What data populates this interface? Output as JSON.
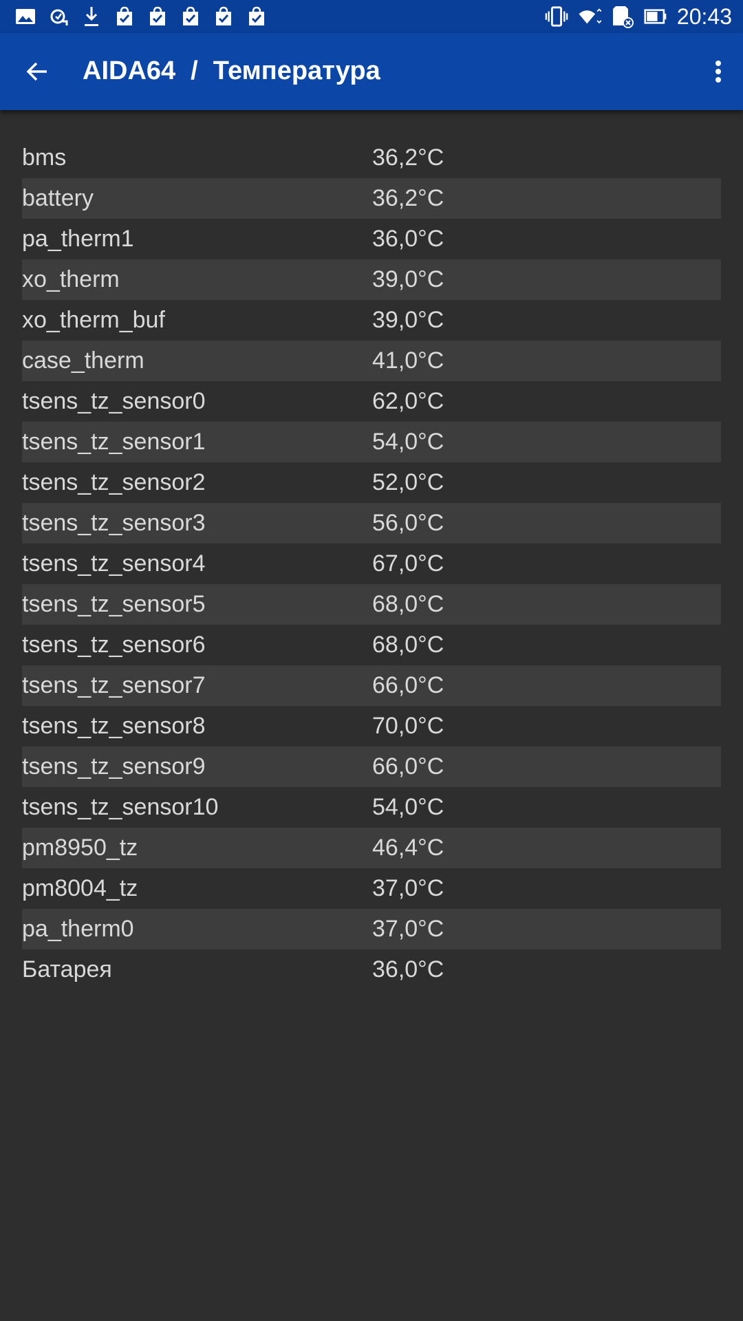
{
  "status_bar": {
    "time": "20:43",
    "left_icons": [
      "gallery-icon",
      "sync-icon",
      "download-icon",
      "bag-check-icon",
      "bag-check-icon",
      "bag-check-icon",
      "bag-check-icon",
      "bag-check-icon"
    ],
    "right_icons": [
      "vibrate-icon",
      "wifi-icon",
      "sd-card-icon",
      "battery-icon"
    ]
  },
  "app_bar": {
    "app_name": "AIDA64",
    "separator": "/",
    "page_title": "Температура",
    "color": "#0c47a8"
  },
  "sensors": [
    {
      "name": "bms",
      "value": "36,2°C"
    },
    {
      "name": "battery",
      "value": "36,2°C"
    },
    {
      "name": "pa_therm1",
      "value": "36,0°C"
    },
    {
      "name": "xo_therm",
      "value": "39,0°C"
    },
    {
      "name": "xo_therm_buf",
      "value": "39,0°C"
    },
    {
      "name": "case_therm",
      "value": "41,0°C"
    },
    {
      "name": "tsens_tz_sensor0",
      "value": "62,0°C"
    },
    {
      "name": "tsens_tz_sensor1",
      "value": "54,0°C"
    },
    {
      "name": "tsens_tz_sensor2",
      "value": "52,0°C"
    },
    {
      "name": "tsens_tz_sensor3",
      "value": "56,0°C"
    },
    {
      "name": "tsens_tz_sensor4",
      "value": "67,0°C"
    },
    {
      "name": "tsens_tz_sensor5",
      "value": "68,0°C"
    },
    {
      "name": "tsens_tz_sensor6",
      "value": "68,0°C"
    },
    {
      "name": "tsens_tz_sensor7",
      "value": "66,0°C"
    },
    {
      "name": "tsens_tz_sensor8",
      "value": "70,0°C"
    },
    {
      "name": "tsens_tz_sensor9",
      "value": "66,0°C"
    },
    {
      "name": "tsens_tz_sensor10",
      "value": "54,0°C"
    },
    {
      "name": "pm8950_tz",
      "value": "46,4°C"
    },
    {
      "name": "pm8004_tz",
      "value": "37,0°C"
    },
    {
      "name": "pa_therm0",
      "value": "37,0°C"
    },
    {
      "name": "Батарея",
      "value": "36,0°C"
    }
  ]
}
